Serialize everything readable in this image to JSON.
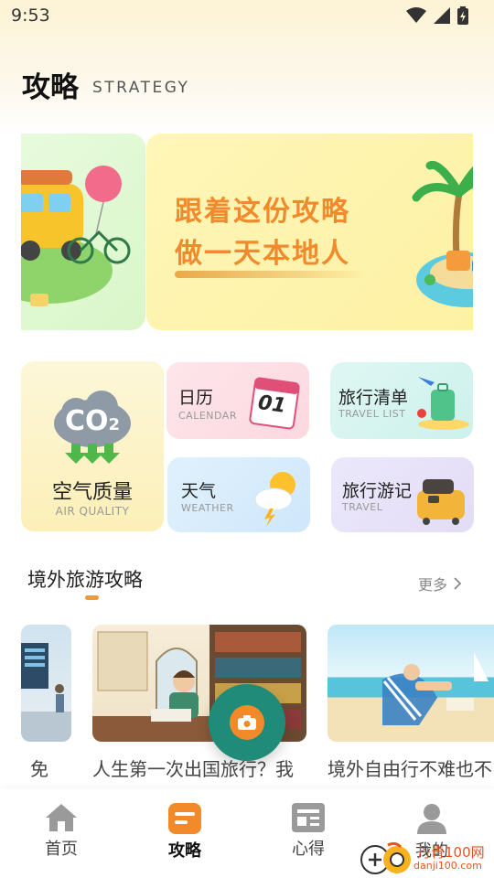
{
  "status": {
    "time": "9:53"
  },
  "header": {
    "title": "攻略",
    "subtitle": "STRATEGY"
  },
  "banner": {
    "line1": "跟着这份攻略",
    "line2": "做一天本地人"
  },
  "tools": {
    "air": {
      "title": "空气质量",
      "sub": "AIR QUALITY",
      "icon_text": "CO",
      "icon_sub": "2"
    },
    "calendar": {
      "title": "日历",
      "sub": "CALENDAR",
      "icon_text": "01"
    },
    "list": {
      "title": "旅行清单",
      "sub": "TRAVEL LIST"
    },
    "weather": {
      "title": "天气",
      "sub": "WEATHER"
    },
    "travel": {
      "title": "旅行游记",
      "sub": "TRAVEL"
    }
  },
  "section": {
    "title": "境外旅游攻略",
    "more": "更多"
  },
  "articles": [
    {
      "title": "免"
    },
    {
      "title": "人生第一次出国旅行？我"
    },
    {
      "title": "境外自由行不难也不"
    }
  ],
  "nav": [
    {
      "label": "首页"
    },
    {
      "label": "攻略",
      "active": true
    },
    {
      "label": "心得"
    },
    {
      "label": "我的"
    }
  ],
  "watermark": {
    "text": "丹青100网",
    "sub": "danji100.com"
  },
  "colors": {
    "accent": "#f09a35",
    "fab": "#1f8b78",
    "banner_text": "#f08a2c"
  }
}
